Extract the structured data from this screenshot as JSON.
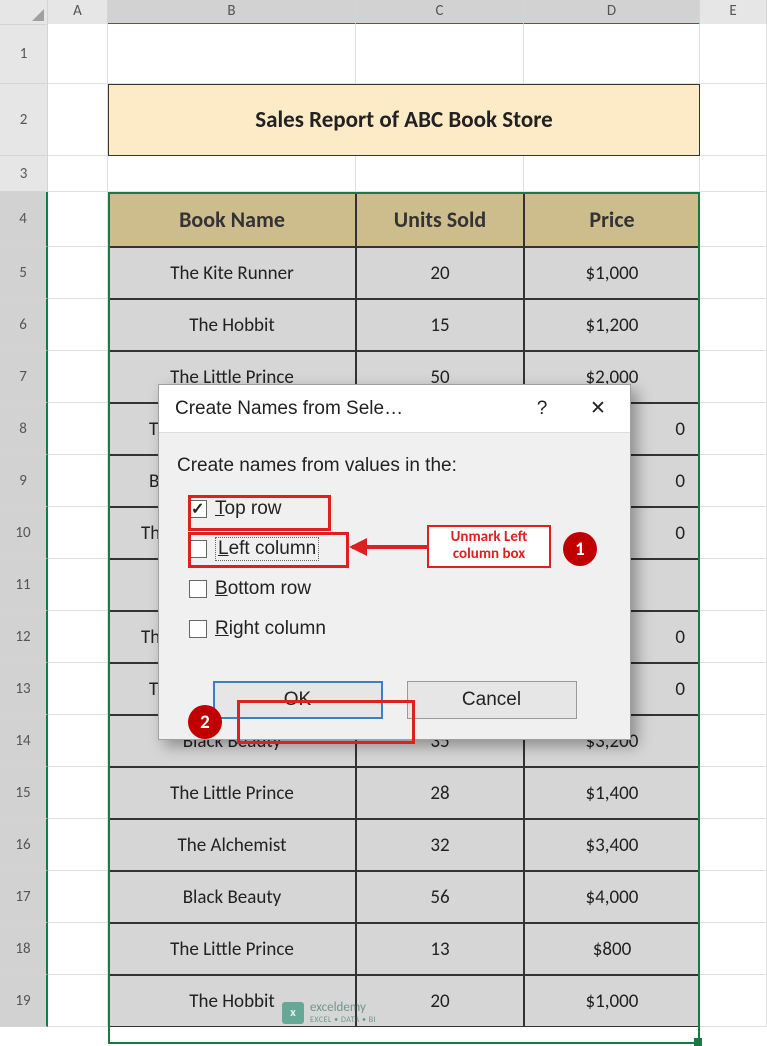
{
  "columns": [
    "",
    "A",
    "B",
    "C",
    "D",
    "E"
  ],
  "selected_cols": [
    "B",
    "C",
    "D"
  ],
  "rows": [
    1,
    2,
    3,
    4,
    5,
    6,
    7,
    8,
    9,
    10,
    11,
    12,
    13,
    14,
    15,
    16,
    17,
    18,
    19
  ],
  "selected_rows_from": 4,
  "selected_rows_to": 19,
  "title": "Sales Report of ABC Book Store",
  "headers": [
    "Book Name",
    "Units Sold",
    "Price"
  ],
  "data": [
    {
      "name": "The Kite Runner",
      "units": "20",
      "price": "$1,000"
    },
    {
      "name": "The Hobbit",
      "units": "15",
      "price": "$1,200"
    },
    {
      "name": "The Little Prince",
      "units": "50",
      "price": "$2,000"
    },
    {
      "name": "Th",
      "units": "",
      "price": "0"
    },
    {
      "name": "B",
      "units": "",
      "price": "0"
    },
    {
      "name": "The",
      "units": "",
      "price": "0"
    },
    {
      "name": "",
      "units": "",
      "price": ""
    },
    {
      "name": "The",
      "units": "",
      "price": "0"
    },
    {
      "name": "Th",
      "units": "",
      "price": "0"
    },
    {
      "name": "Black Beauty",
      "units": "35",
      "price": "$3,200"
    },
    {
      "name": "The Little Prince",
      "units": "28",
      "price": "$1,400"
    },
    {
      "name": "The Alchemist",
      "units": "32",
      "price": "$3,400"
    },
    {
      "name": "Black Beauty",
      "units": "56",
      "price": "$4,000"
    },
    {
      "name": "The Little Prince",
      "units": "13",
      "price": "$800"
    },
    {
      "name": "The Hobbit",
      "units": "20",
      "price": "$1,000"
    }
  ],
  "dialog": {
    "title": "Create Names from Sele…",
    "help_icon": "?",
    "close_icon": "✕",
    "prompt": "Create names from values in the:",
    "options": {
      "top_row": {
        "label_pre": "T",
        "label_post": "op row",
        "checked": true
      },
      "left_col": {
        "label_pre": "L",
        "label_post": "eft column",
        "checked": false
      },
      "bottom_row": {
        "label_pre": "B",
        "label_post": "ottom row",
        "checked": false
      },
      "right_col": {
        "label_pre": "R",
        "label_post": "ight column",
        "checked": false
      }
    },
    "buttons": {
      "ok": "OK",
      "cancel": "Cancel"
    }
  },
  "annotations": {
    "callout": "Unmark Left column box",
    "step1": "1",
    "step2": "2"
  },
  "watermark": {
    "brand": "exceldemy",
    "tag": "EXCEL • DATA • BI"
  }
}
